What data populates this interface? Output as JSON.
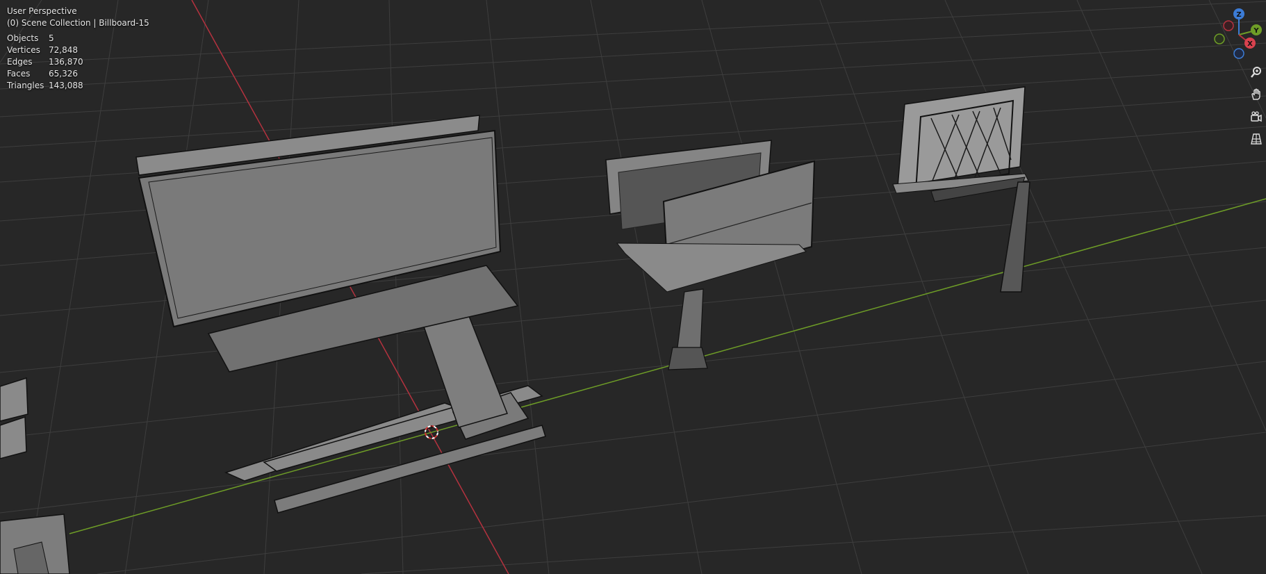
{
  "viewport": {
    "view_name": "User Perspective",
    "collection_path": "(0) Scene Collection | Billboard-15",
    "stats": [
      {
        "label": "Objects",
        "value": "5"
      },
      {
        "label": "Vertices",
        "value": "72,848"
      },
      {
        "label": "Edges",
        "value": "136,870"
      },
      {
        "label": "Faces",
        "value": "65,326"
      },
      {
        "label": "Triangles",
        "value": "143,088"
      }
    ]
  },
  "gizmo": {
    "z": "Z",
    "y": "Y",
    "x": "X"
  },
  "tools": [
    {
      "name": "zoom-icon"
    },
    {
      "name": "hand-pan-icon"
    },
    {
      "name": "camera-view-icon"
    },
    {
      "name": "perspective-grid-icon"
    }
  ],
  "colors": {
    "background": "#272727",
    "grid": "#3d3d3d",
    "x_axis": "#b5323f",
    "y_axis": "#6e9d27",
    "z_axis": "#3c7cd6",
    "model": "#7a7a7a"
  }
}
